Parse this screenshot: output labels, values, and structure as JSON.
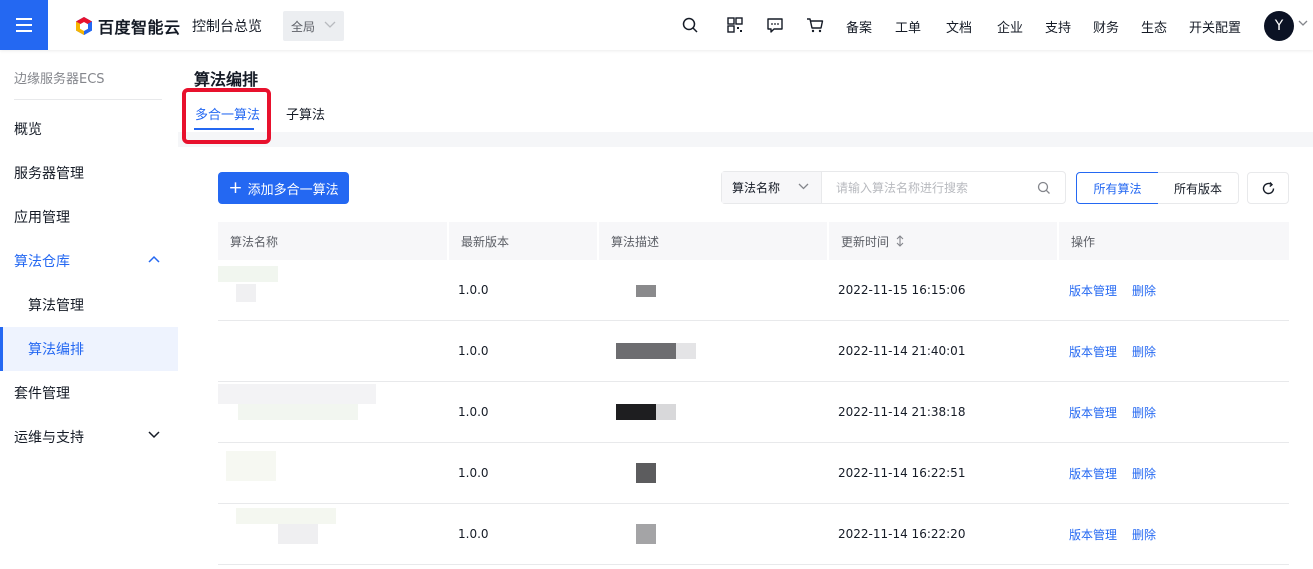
{
  "topbar": {
    "brand": "百度智能云",
    "console_title": "控制台总览",
    "region": "全局",
    "nav": [
      "备案",
      "工单",
      "文档",
      "企业",
      "支持",
      "财务",
      "生态",
      "开关配置"
    ],
    "avatar_initial": "Y",
    "icons": [
      "search-icon",
      "qrcode-icon",
      "message-icon",
      "cart-icon"
    ]
  },
  "sidebar": {
    "product": "边缘服务器ECS",
    "items": [
      {
        "label": "概览"
      },
      {
        "label": "服务器管理"
      },
      {
        "label": "应用管理"
      },
      {
        "label": "算法仓库"
      },
      {
        "label": "算法管理"
      },
      {
        "label": "算法编排"
      },
      {
        "label": "套件管理"
      },
      {
        "label": "运维与支持"
      }
    ]
  },
  "page": {
    "title": "算法编排",
    "tabs": [
      "多合一算法",
      "子算法"
    ],
    "active_tab": 0
  },
  "toolbar": {
    "add_label": "添加多合一算法",
    "search_field": "算法名称",
    "search_placeholder": "请输入算法名称进行搜索",
    "filter_all": "所有算法",
    "filter_versions": "所有版本"
  },
  "table": {
    "columns": [
      "算法名称",
      "最新版本",
      "算法描述",
      "更新时间",
      "操作"
    ],
    "rows": [
      {
        "version": "1.0.0",
        "updated": "2022-11-15 16:15:06"
      },
      {
        "version": "1.0.0",
        "updated": "2022-11-14 21:40:01"
      },
      {
        "version": "1.0.0",
        "updated": "2022-11-14 21:38:18"
      },
      {
        "version": "1.0.0",
        "updated": "2022-11-14 16:22:51"
      },
      {
        "version": "1.0.0",
        "updated": "2022-11-14 16:22:20"
      }
    ],
    "action_manage": "版本管理",
    "action_delete": "删除"
  },
  "colors": {
    "primary": "#2468f2",
    "highlight": "#e8112d"
  }
}
